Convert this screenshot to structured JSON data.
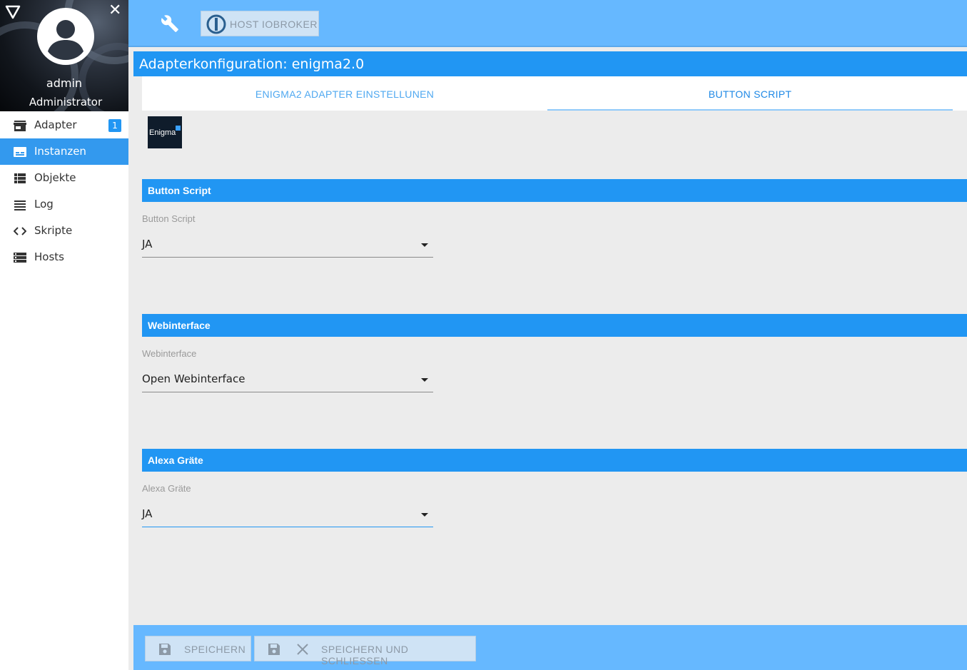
{
  "sidebar": {
    "user": {
      "name": "admin",
      "role": "Administrator"
    },
    "close_symbol": "✕",
    "items": [
      {
        "label": "Adapter",
        "icon": "store-icon",
        "badge": "1",
        "active": false
      },
      {
        "label": "Instanzen",
        "icon": "instances-icon",
        "active": true
      },
      {
        "label": "Objekte",
        "icon": "list-icon",
        "active": false
      },
      {
        "label": "Log",
        "icon": "log-lines-icon",
        "active": false
      },
      {
        "label": "Skripte",
        "icon": "code-icon",
        "active": false
      },
      {
        "label": "Hosts",
        "icon": "server-icon",
        "active": false
      }
    ]
  },
  "topbar": {
    "host_button_label": "HOST IOBROKER"
  },
  "config": {
    "title": "Adapterkonfiguration: enigma2.0",
    "tabs": [
      {
        "label": "ENIGMA2 ADAPTER EINSTELLUNEN",
        "selected": false
      },
      {
        "label": "BUTTON SCRIPT",
        "selected": true
      }
    ],
    "logo_text": "Enigma",
    "sections": [
      {
        "header": "Button Script",
        "field_label": "Button Script",
        "value": "JA"
      },
      {
        "header": "Webinterface",
        "field_label": "Webinterface",
        "value": "Open Webinterface"
      },
      {
        "header": "Alexa Gräte",
        "field_label": "Alexa Gräte",
        "value": "JA"
      }
    ]
  },
  "footer": {
    "save_label": "SPEICHERN",
    "save_close_label": "SPEICHERN UND SCHLIESSEN"
  },
  "colors": {
    "primary": "#2196f3",
    "topbar": "#66b8ff",
    "active_nav": "#3399ee"
  }
}
